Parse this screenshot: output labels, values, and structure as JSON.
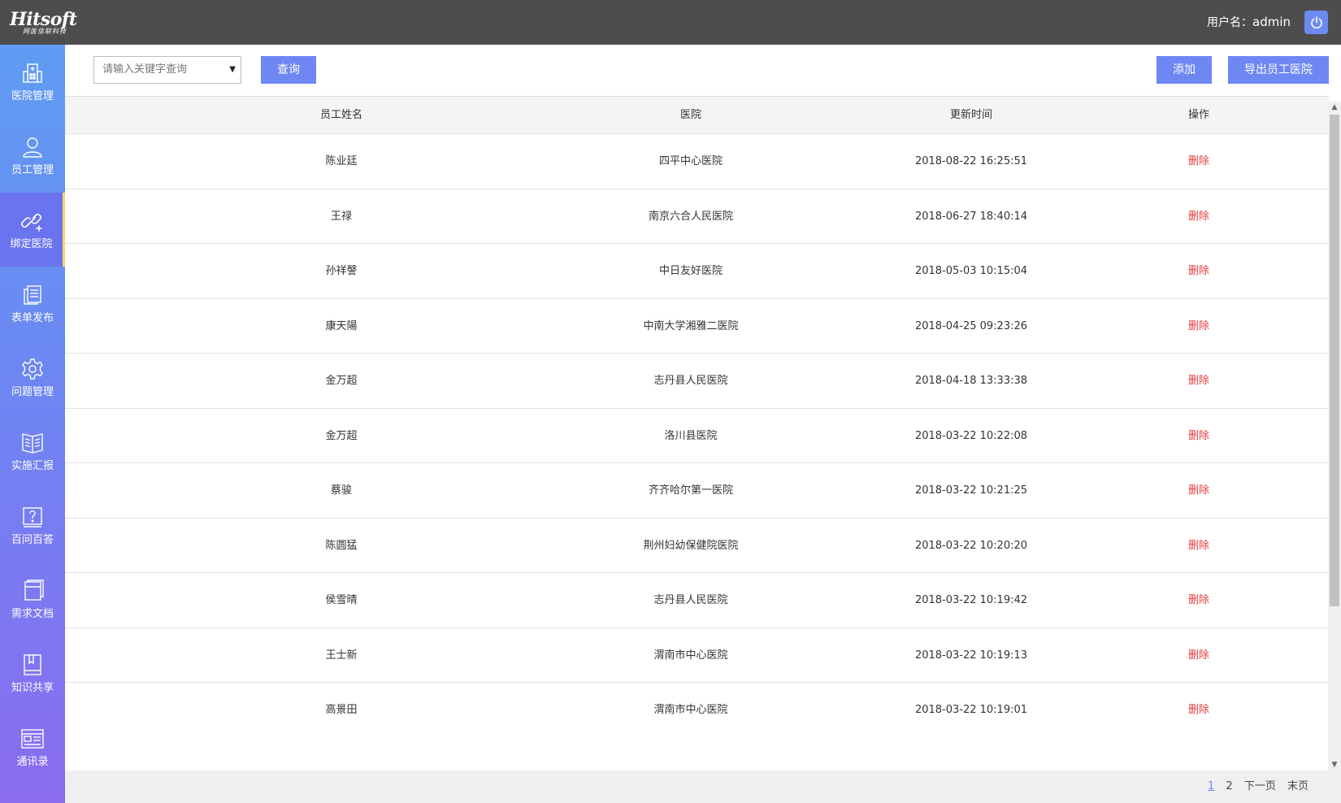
{
  "header": {
    "logo_main": "Hitsoft",
    "logo_sub": "网医信联科技",
    "user_label": "用户名：",
    "username": "admin",
    "power_icon": "power-icon"
  },
  "sidebar": {
    "items": [
      {
        "label": "医院管理",
        "icon": "hospital-icon"
      },
      {
        "label": "员工管理",
        "icon": "user-icon"
      },
      {
        "label": "绑定医院",
        "icon": "link-icon",
        "active": true
      },
      {
        "label": "表单发布",
        "icon": "form-icon"
      },
      {
        "label": "问题管理",
        "icon": "gear-icon"
      },
      {
        "label": "实施汇报",
        "icon": "book-open-icon"
      },
      {
        "label": "百问百答",
        "icon": "question-icon"
      },
      {
        "label": "需求文档",
        "icon": "document-icon"
      },
      {
        "label": "知识共享",
        "icon": "book-icon"
      },
      {
        "label": "通讯录",
        "icon": "contacts-icon"
      }
    ],
    "colors": {
      "top": "#5f9cf3",
      "bottom": "#8a6cf0",
      "active_marker": "#f6d76a"
    }
  },
  "toolbar": {
    "search_placeholder": "请输入关键字查询",
    "query_label": "查询",
    "add_label": "添加",
    "export_label": "导出员工医院"
  },
  "table": {
    "headers": {
      "name": "员工姓名",
      "hospital": "医院",
      "time": "更新时间",
      "op": "操作"
    },
    "rows": [
      {
        "name": "陈业廷",
        "hospital": "四平中心医院",
        "time": "2018-08-22 16:25:51",
        "op": "删除"
      },
      {
        "name": "王禄",
        "hospital": "南京六合人民医院",
        "time": "2018-06-27 18:40:14",
        "op": "删除"
      },
      {
        "name": "孙祥謦",
        "hospital": "中日友好医院",
        "time": "2018-05-03 10:15:04",
        "op": "删除"
      },
      {
        "name": "康天陽",
        "hospital": "中南大学湘雅二医院",
        "time": "2018-04-25 09:23:26",
        "op": "删除"
      },
      {
        "name": "金万超",
        "hospital": "志丹县人民医院",
        "time": "2018-04-18 13:33:38",
        "op": "删除"
      },
      {
        "name": "金万超",
        "hospital": "洛川县医院",
        "time": "2018-03-22 10:22:08",
        "op": "删除"
      },
      {
        "name": "蔡骏",
        "hospital": "齐齐哈尔第一医院",
        "time": "2018-03-22 10:21:25",
        "op": "删除"
      },
      {
        "name": "陈圆猛",
        "hospital": "荆州妇幼保健院医院",
        "time": "2018-03-22 10:20:20",
        "op": "删除"
      },
      {
        "name": "侯雪晴",
        "hospital": "志丹县人民医院",
        "time": "2018-03-22 10:19:42",
        "op": "删除"
      },
      {
        "name": "王士新",
        "hospital": "渭南市中心医院",
        "time": "2018-03-22 10:19:13",
        "op": "删除"
      },
      {
        "name": "高景田",
        "hospital": "渭南市中心医院",
        "time": "2018-03-22 10:19:01",
        "op": "删除"
      }
    ]
  },
  "pagination": {
    "pages": [
      "1",
      "2"
    ],
    "current": "1",
    "next_label": "下一页",
    "last_label": "末页"
  },
  "colors": {
    "accent": "#6e87f3",
    "topbar": "#4d4d4d",
    "delete": "#e53b3b"
  }
}
